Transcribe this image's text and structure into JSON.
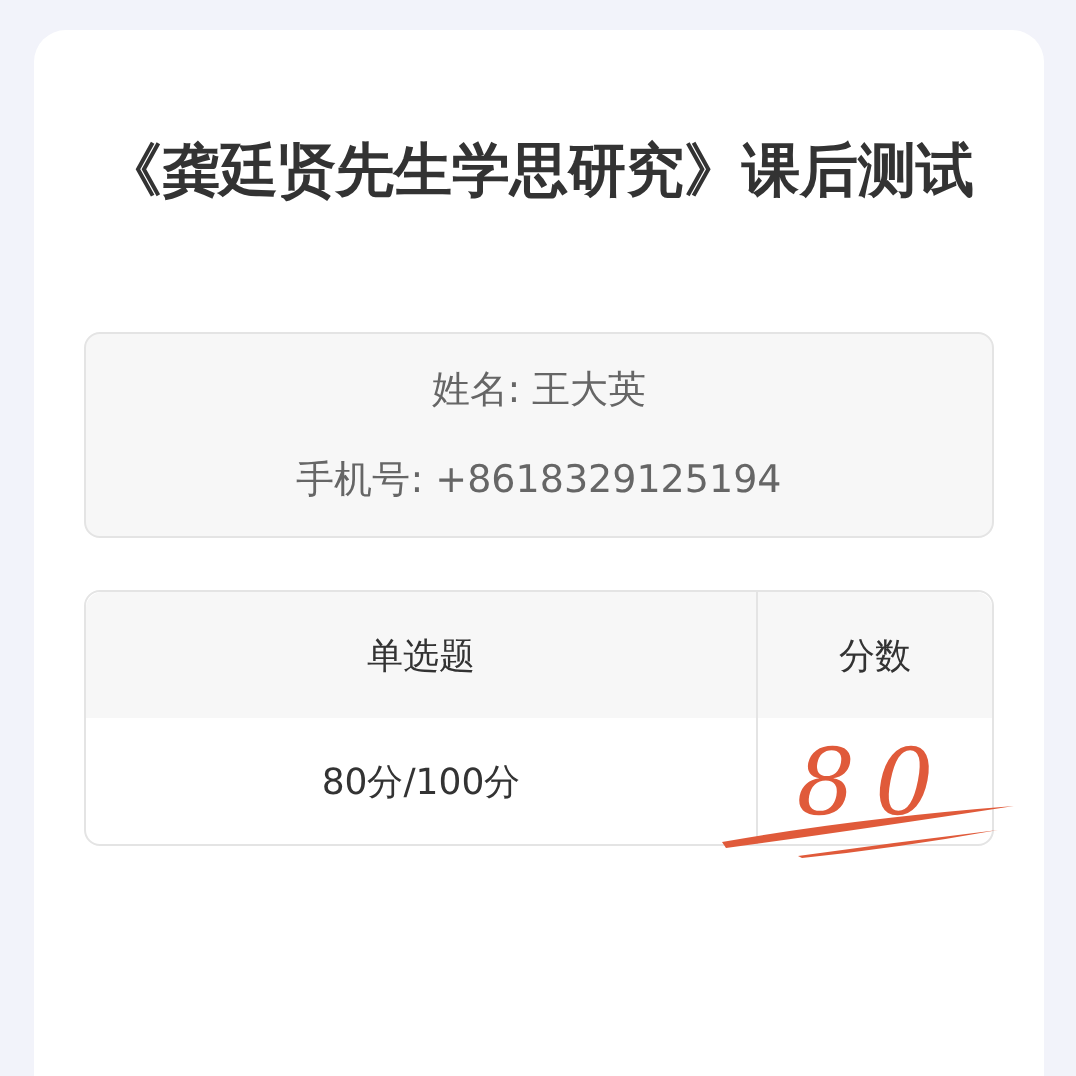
{
  "title": "《龚廷贤先生学思研究》课后测试",
  "info": [
    {
      "label": "姓名: 王大英"
    },
    {
      "label": "手机号: +8618329125194"
    }
  ],
  "table": {
    "columns": [
      "单选题",
      "分数"
    ],
    "rows": [
      {
        "result": "80分/100分",
        "score": "80"
      }
    ]
  }
}
